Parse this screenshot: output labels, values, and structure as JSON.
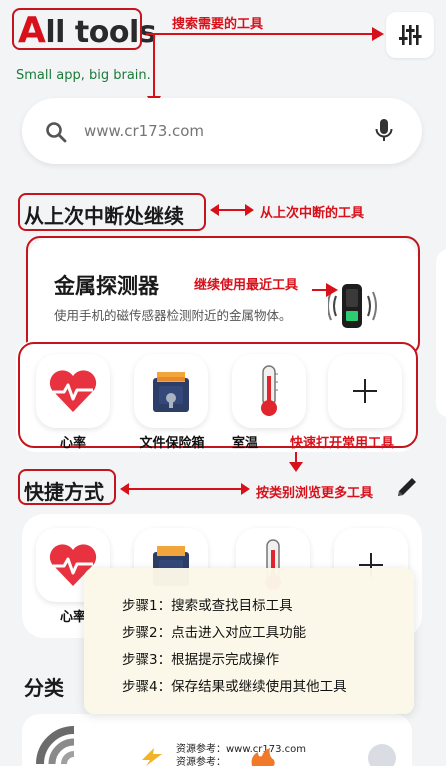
{
  "header": {
    "title_first_letter": "A",
    "title_rest": "ll tools",
    "subtitle": "Small app, big brain."
  },
  "search": {
    "placeholder": "www.cr173.com"
  },
  "annotations": {
    "search_tools": "搜索需要的工具",
    "continue_tools": "从上次中断的工具",
    "recent_tools": "继续使用最近工具",
    "quick_open": "快速打开常用工具",
    "browse_category": "按类别浏览更多工具"
  },
  "continue_section": {
    "title": "从上次中断处继续",
    "card_title": "金属探测器",
    "card_desc": "使用手机的磁传感器检测附近的金属物体。"
  },
  "favorites": [
    {
      "label": "心率",
      "icon": "heart-pulse-icon"
    },
    {
      "label": "文件保险箱",
      "icon": "file-vault-icon"
    },
    {
      "label": "室温",
      "icon": "thermometer-icon"
    },
    {
      "label": "",
      "icon": "plus-icon"
    }
  ],
  "shortcuts_section": {
    "title": "快捷方式",
    "items": [
      {
        "label": "心率",
        "icon": "heart-pulse-icon"
      }
    ]
  },
  "steps": [
    "步骤1：搜索或查找目标工具",
    "步骤2：点击进入对应工具功能",
    "步骤3：根据提示完成操作",
    "步骤4：保存结果或继续使用其他工具"
  ],
  "categories_section": {
    "title": "分类",
    "watermark_line1": "资源参考：www.cr173.com",
    "watermark_line2": "资源参考："
  },
  "colors": {
    "annotation_red": "#d8101a",
    "accent_green": "#1b7a3a",
    "background": "#f3f4f6"
  }
}
